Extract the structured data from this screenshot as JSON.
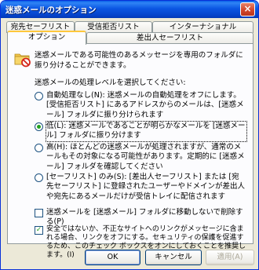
{
  "window": {
    "title": "迷惑メールのオプション",
    "close_label": "×"
  },
  "tabs_row1": [
    {
      "label": "宛先セーフリスト"
    },
    {
      "label": "受信拒否リスト"
    },
    {
      "label": "インターナショナル"
    }
  ],
  "tabs_row2": [
    {
      "label": "オプション",
      "active": true
    },
    {
      "label": "差出人セーフリスト"
    }
  ],
  "options_panel": {
    "description": "迷惑メールである可能性のあるメッセージを専用のフォルダに振り分けることができます。",
    "level_prompt": "迷惑メールの処理レベルを選択してください:",
    "levels": [
      {
        "label": "自動処理なし(N): 迷惑メールの自動処理をオフにします。[受信拒否リスト] にあるアドレスからのメールは、[迷惑メール] フォルダに振り分けられます",
        "selected": false
      },
      {
        "label": "低(L): 迷惑メールであることが明らかなメールを [迷惑メール] フォルダに振り分けます",
        "selected": true
      },
      {
        "label": "高(H): ほとんどの迷惑メールが処理されますが、通常のメールもその対象になる可能性があります。定期的に [迷惑メール] フォルダを確認してください",
        "selected": false
      },
      {
        "label": "[セーフリスト] のみ(S): [差出人セーフリスト] または [宛先セーフリスト] に登録されたユーザーやドメインが差出人や宛先にあるメールだけが受信トレイに配信されます",
        "selected": false
      }
    ],
    "delete_option": {
      "label": "迷惑メールを [迷惑メール] フォルダに移動しないで削除する(P)",
      "checked": false
    },
    "link_option": {
      "label": "安全ではないか、不正なサイトへのリンクがメッセージに含まれる場合、リンクをオフにする。セキュリティの保護を促進するため、このチェック ボックスをオンにしておくことを推奨します。(I)",
      "checked": true
    }
  },
  "buttons": {
    "ok": "OK",
    "cancel": "キャンセル",
    "apply": "適用(A)"
  },
  "colors": {
    "titlebar": "#0b56e3",
    "dialog": "#ece9d8",
    "active_tab_accent": "#ffc83c"
  }
}
